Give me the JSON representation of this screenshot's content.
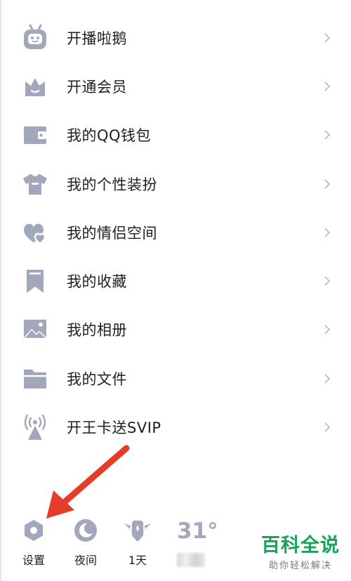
{
  "colors": {
    "icon": "#a3a7bb",
    "chevron": "#b8b8b8",
    "arrow": "#e53c2c",
    "watermark": "#18a35a"
  },
  "menu": {
    "items": [
      {
        "label": "开播啦鹅",
        "icon": "robot-tv-icon"
      },
      {
        "label": "开通会员",
        "icon": "crown-icon"
      },
      {
        "label": "我的QQ钱包",
        "icon": "wallet-icon"
      },
      {
        "label": "我的个性装扮",
        "icon": "shirt-icon"
      },
      {
        "label": "我的情侣空间",
        "icon": "hearts-icon"
      },
      {
        "label": "我的收藏",
        "icon": "bookmark-icon"
      },
      {
        "label": "我的相册",
        "icon": "photo-icon"
      },
      {
        "label": "我的文件",
        "icon": "folder-icon"
      },
      {
        "label": "开王卡送SVIP",
        "icon": "signal-tower-icon"
      }
    ]
  },
  "bottom": {
    "settings_label": "设置",
    "night_label": "夜间",
    "days_label": "1天",
    "temperature": "31°"
  },
  "watermark": {
    "title": "百科全说",
    "subtitle": "助你轻松解决"
  }
}
